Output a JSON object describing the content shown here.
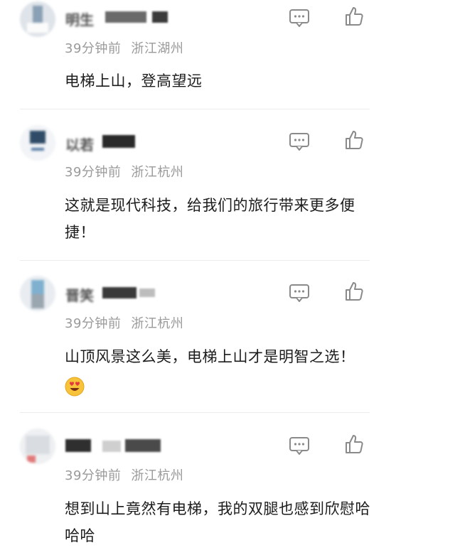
{
  "comments": [
    {
      "name": "明生",
      "time": "39分钟前",
      "location": "浙江湖州",
      "text": "电梯上山，登高望远",
      "emoji": ""
    },
    {
      "name": "以若",
      "time": "39分钟前",
      "location": "浙江杭州",
      "text": "这就是现代科技，给我们的旅行带来更多便捷！",
      "emoji": ""
    },
    {
      "name": "晋笑",
      "time": "39分钟前",
      "location": "浙江杭州",
      "text": "山顶风景这么美，电梯上山才是明智之选！",
      "emoji": "heart-eyes-emoji"
    },
    {
      "name": "",
      "time": "39分钟前",
      "location": "浙江杭州",
      "text": "想到山上竟然有电梯，我的双腿也感到欣慰哈哈哈",
      "emoji": ""
    }
  ],
  "icons": {
    "reply": "comment-icon",
    "like": "thumbs-up-icon"
  },
  "colors": {
    "meta": "#9a9a9a",
    "text": "#1c1c1c",
    "icon": "#8a8a8a",
    "divider": "#ececec"
  }
}
